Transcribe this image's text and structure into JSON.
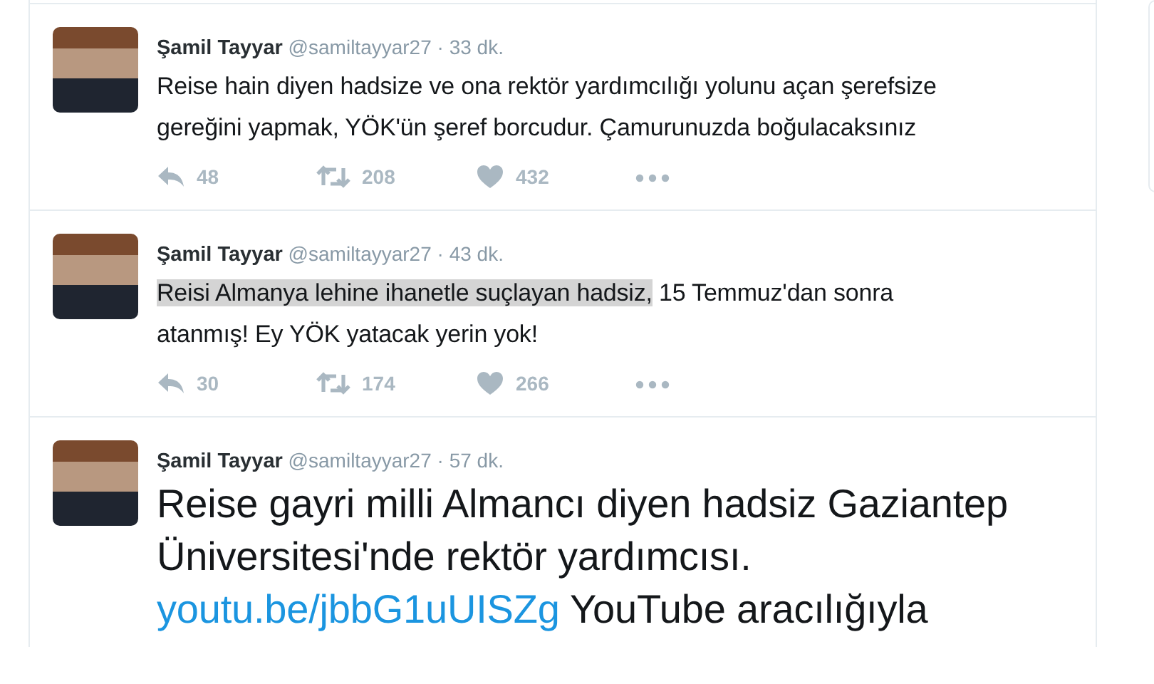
{
  "tweets": [
    {
      "name": "Şamil Tayyar",
      "handle": "@samiltayyar27",
      "time": "· 33 dk.",
      "kind": "normal",
      "text": [
        {
          "text": "Reise hain diyen hadsize ve ona rektör yardımcılığı yolunu açan şerefsize gereğini yapmak, YÖK'ün şeref borcudur. Çamurunuzda boğulacaksınız",
          "kind": "plain",
          "selected": false
        }
      ],
      "actions": {
        "replies": "48",
        "retweets": "208",
        "likes": "432"
      }
    },
    {
      "name": "Şamil Tayyar",
      "handle": "@samiltayyar27",
      "time": "· 43 dk.",
      "kind": "normal",
      "text": [
        {
          "text": "Reisi Almanya lehine ihanetle suçlayan hadsiz,",
          "kind": "plain",
          "selected": true
        },
        {
          "text": " 15 Temmuz'dan sonra atanmış! Ey YÖK yatacak yerin yok!",
          "kind": "plain",
          "selected": false
        }
      ],
      "actions": {
        "replies": "30",
        "retweets": "174",
        "likes": "266"
      }
    },
    {
      "name": "Şamil Tayyar",
      "handle": "@samiltayyar27",
      "time": "· 57 dk.",
      "kind": "large",
      "text": [
        {
          "text": "Reise gayri milli Almancı diyen hadsiz Gaziantep Üniversitesi'nde rektör yardımcısı. ",
          "kind": "plain",
          "selected": false
        },
        {
          "text": "youtu.be/jbbG1uUISZg",
          "kind": "link",
          "selected": false
        },
        {
          "text": " YouTube aracılığıyla",
          "kind": "plain",
          "selected": false
        }
      ]
    }
  ]
}
